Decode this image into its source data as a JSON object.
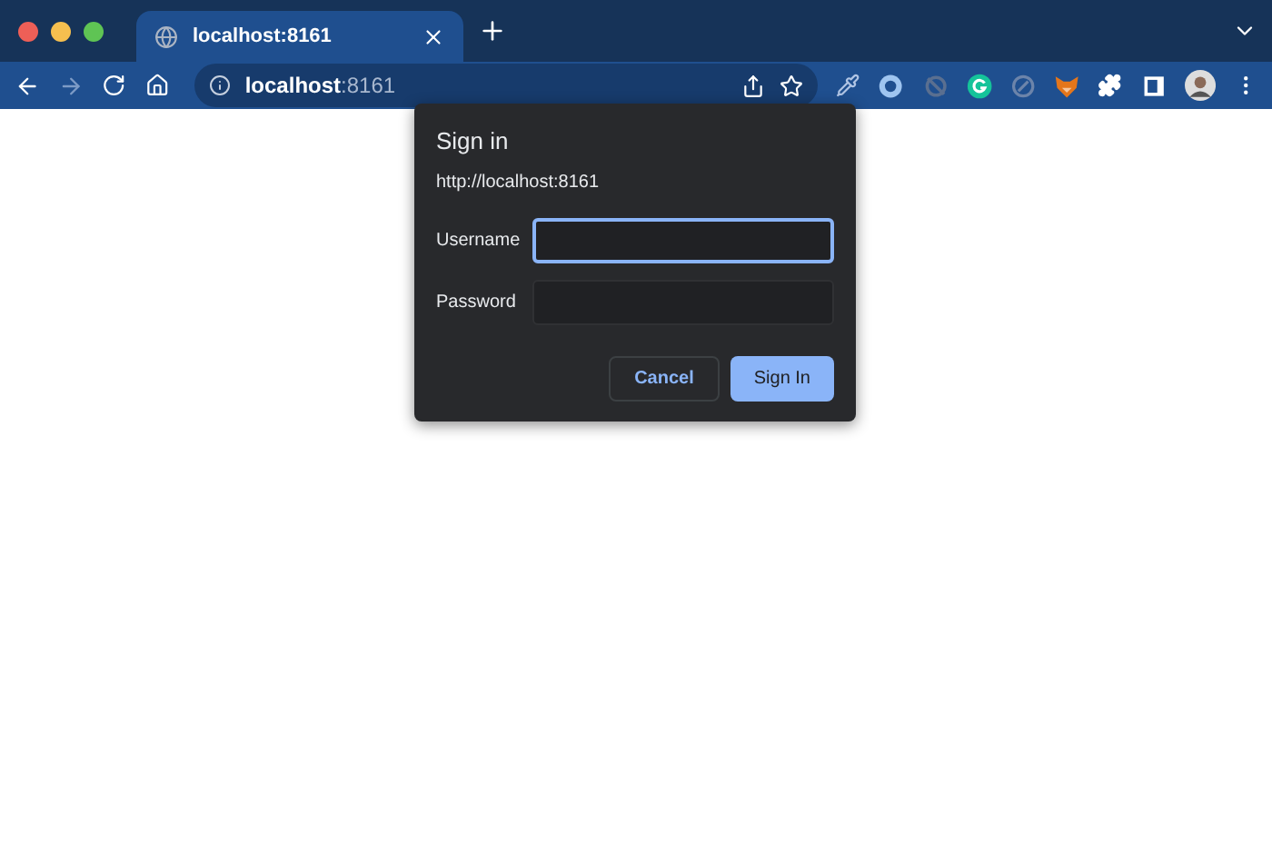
{
  "tabs": [
    {
      "title": "localhost:8161",
      "selected": true
    }
  ],
  "omnibox": {
    "host": "localhost",
    "port": ":8161"
  },
  "dialog": {
    "title": "Sign in",
    "origin": "http://localhost:8161",
    "fields": [
      {
        "label": "Username",
        "focused": true
      },
      {
        "label": "Password",
        "focused": false
      }
    ],
    "buttons": [
      {
        "label": "Cancel",
        "kind": "secondary"
      },
      {
        "label": "Sign In",
        "kind": "primary"
      }
    ]
  }
}
